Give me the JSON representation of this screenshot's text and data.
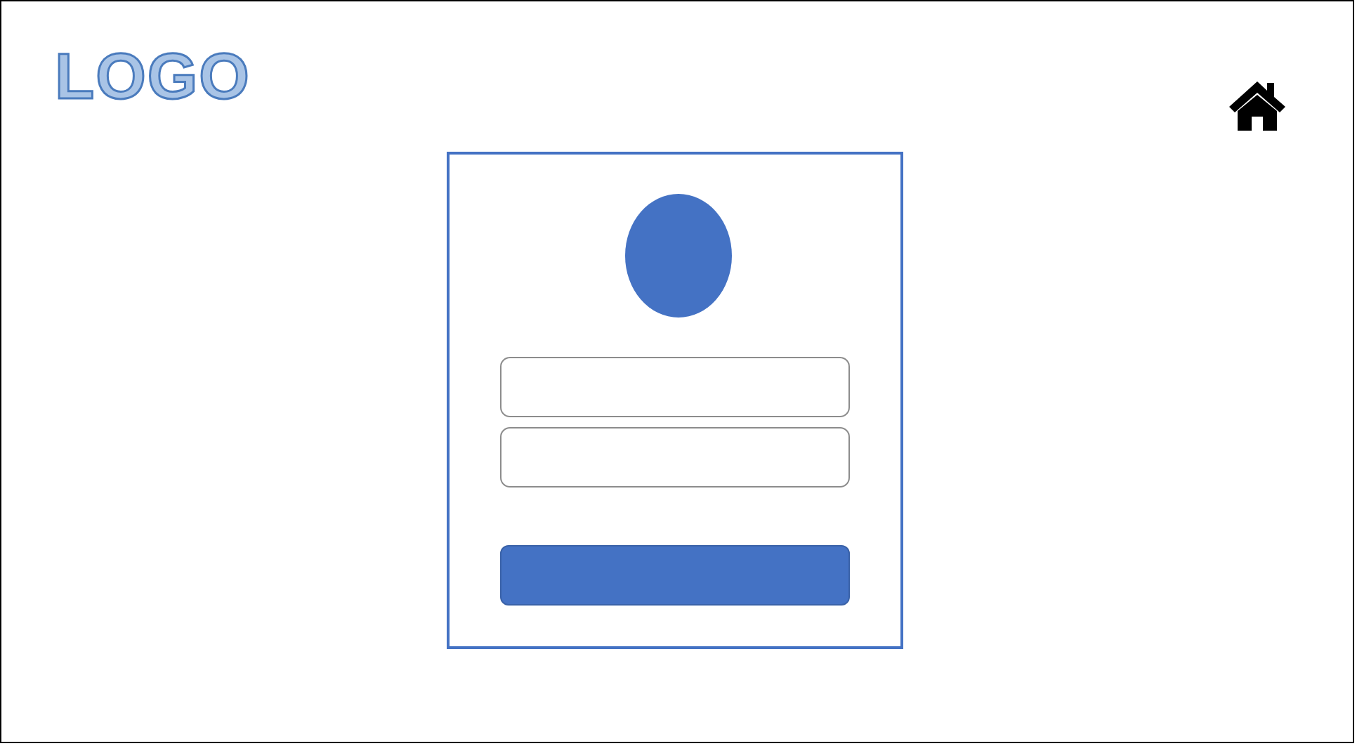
{
  "logo": {
    "text": "LOGO"
  }
}
